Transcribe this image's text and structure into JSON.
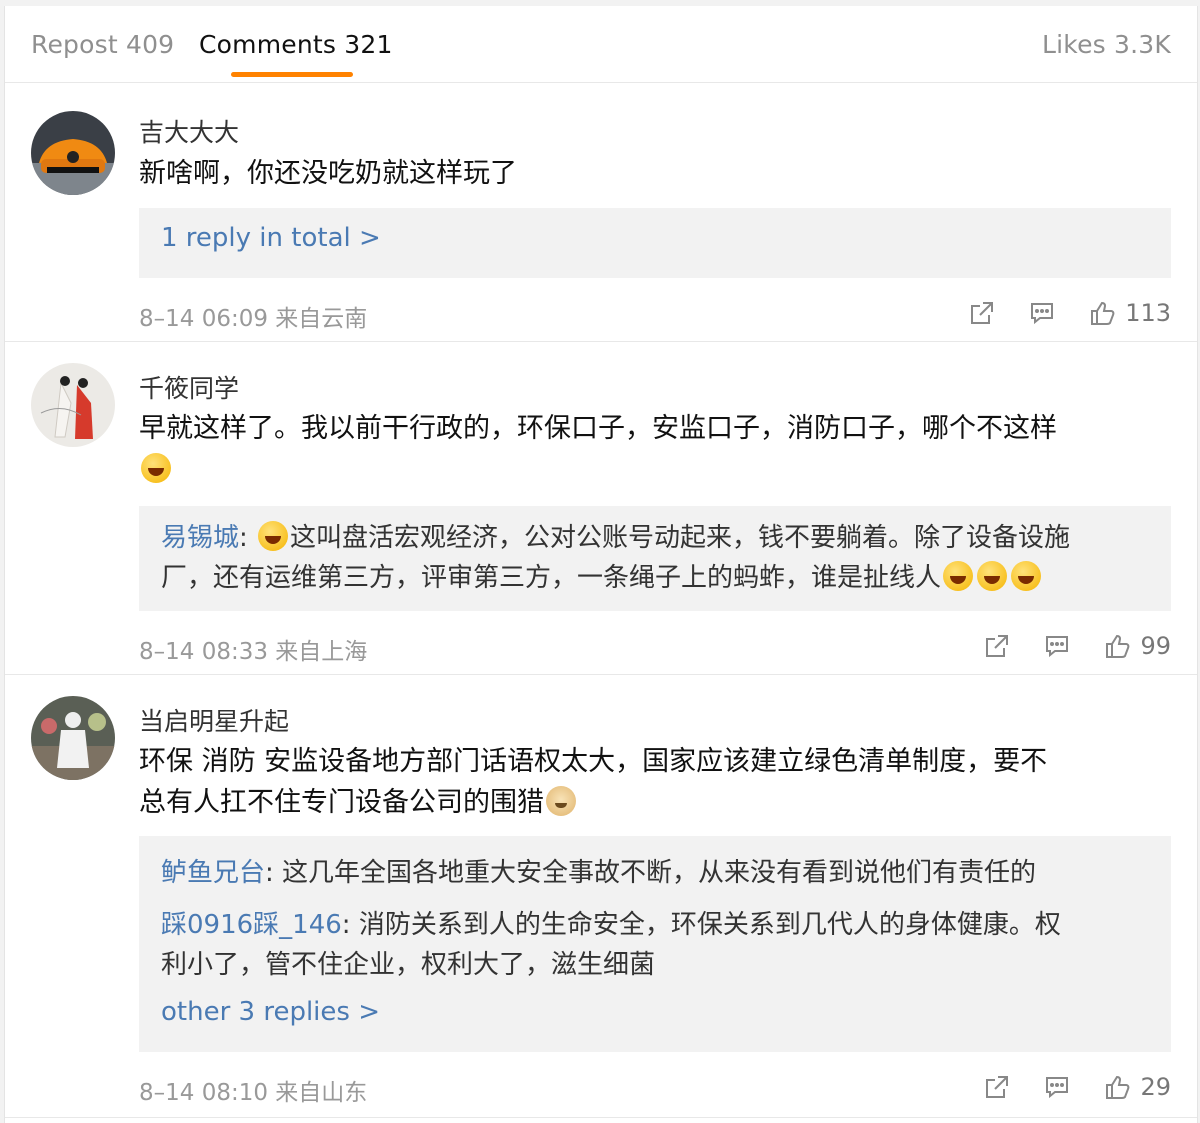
{
  "tabs": {
    "repost": "Repost 409",
    "comments": "Comments 321",
    "likes": "Likes 3.3K"
  },
  "comments": [
    {
      "user": "吉大大大",
      "text": "新啥啊，你还没吃奶就这样玩了",
      "reply_link": "1 reply in total >",
      "meta": "8–14 06:09 来自云南",
      "likes": "113"
    },
    {
      "user": "千筱同学",
      "text": "早就这样了。我以前干行政的，环保口子，安监口子，消防口子，哪个不这样",
      "reply_user": "易锡城",
      "reply_text_1": "这叫盘活宏观经济，公对公账号动起来，钱不要躺着。除了设备设施",
      "reply_text_2": "厂，还有运维第三方，评审第三方，一条绳子上的蚂蚱，谁是扯线人",
      "meta": "8–14 08:33 来自上海",
      "likes": "99"
    },
    {
      "user": "当启明星升起",
      "text_1": "环保  消防  安监设备地方部门话语权太大，国家应该建立绿色清单制度，要不",
      "text_2": "总有人扛不住专门设备公司的围猎",
      "reply1_user": "鲈鱼兄台",
      "reply1_text": "这几年全国各地重大安全事故不断，从来没有看到说他们有责任的",
      "reply2_user": "踩0916踩_146",
      "reply2_text_1": "消防关系到人的生命安全，环保关系到几代人的身体健康。权",
      "reply2_text_2": "利小了，管不住企业，权利大了，滋生细菌",
      "more_link": "other 3 replies >",
      "meta": "8–14 08:10 来自山东",
      "likes": "29"
    }
  ],
  "colors": {
    "accent": "#ff8200",
    "link": "#4a7ab3",
    "muted": "#999999"
  }
}
